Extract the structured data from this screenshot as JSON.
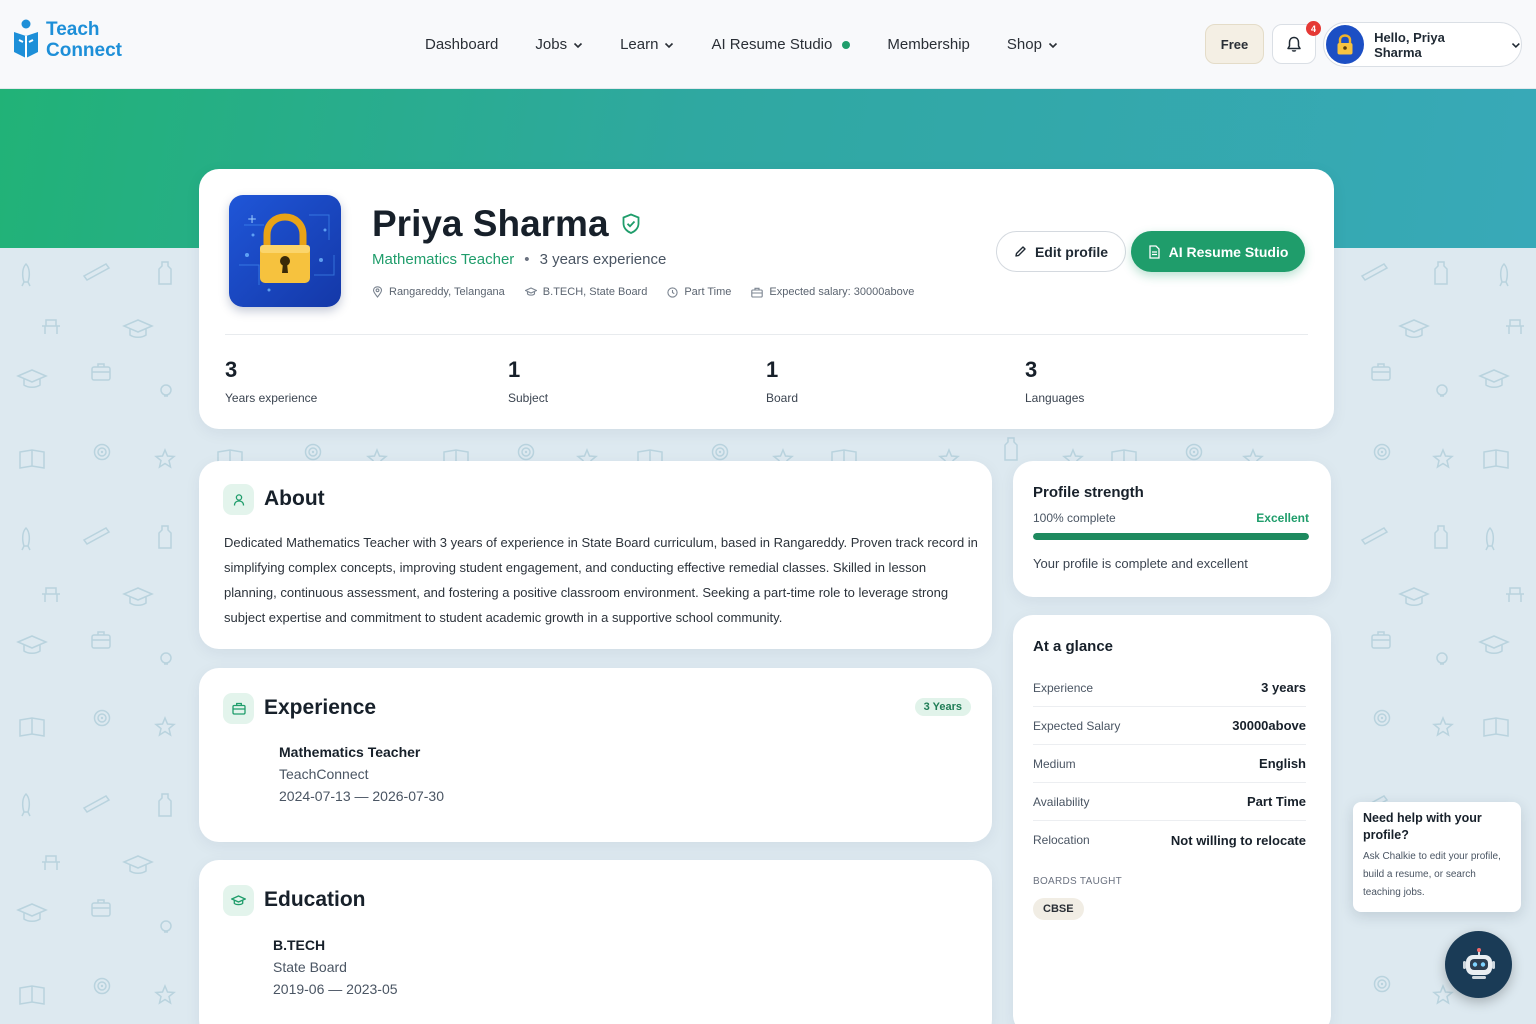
{
  "brand": {
    "line1": "Teach",
    "line2": "Connect",
    "color": "#1d8fd8"
  },
  "nav": {
    "items": [
      {
        "label": "Dashboard",
        "dropdown": false
      },
      {
        "label": "Jobs",
        "dropdown": true
      },
      {
        "label": "Learn",
        "dropdown": true
      },
      {
        "label": "AI Resume Studio",
        "dropdown": false,
        "live_dot": true
      },
      {
        "label": "Membership",
        "dropdown": false
      },
      {
        "label": "Shop",
        "dropdown": true
      }
    ]
  },
  "header": {
    "plan_label": "Free",
    "notification_count": "4",
    "greeting": "Hello, Priya Sharma"
  },
  "profile": {
    "name": "Priya Sharma",
    "role": "Mathematics Teacher",
    "separator": "•",
    "experience": "3 years experience",
    "meta": {
      "location": "Rangareddy, Telangana",
      "education": "B.TECH, State Board",
      "job_type": "Part Time",
      "salary": "Expected salary: 30000above"
    },
    "edit_label": "Edit profile",
    "ai_label": "AI Resume Studio",
    "stats": [
      {
        "value": "3",
        "label": "Years experience"
      },
      {
        "value": "1",
        "label": "Subject"
      },
      {
        "value": "1",
        "label": "Board"
      },
      {
        "value": "3",
        "label": "Languages"
      }
    ]
  },
  "about": {
    "title": "About",
    "text": "Dedicated Mathematics Teacher with 3 years of experience in State Board curriculum, based in Rangareddy. Proven track record in simplifying complex concepts, improving student engagement, and conducting effective remedial classes. Skilled in lesson planning, continuous assessment, and fostering a positive classroom environment. Seeking a part-time role to leverage strong subject expertise and commitment to student academic growth in a supportive school community."
  },
  "experience": {
    "title": "Experience",
    "badge": "3 Years",
    "items": [
      {
        "title": "Mathematics Teacher",
        "org": "TeachConnect",
        "dates": "2024-07-13 — 2026-07-30"
      }
    ]
  },
  "education": {
    "title": "Education",
    "items": [
      {
        "title": "B.TECH",
        "org": "State Board",
        "dates": "2019-06 — 2023-05"
      }
    ]
  },
  "strength": {
    "title": "Profile strength",
    "percent_label": "100% complete",
    "percent": 100,
    "level": "Excellent",
    "message": "Your profile is complete and excellent"
  },
  "glance": {
    "title": "At a glance",
    "rows": [
      {
        "key": "Experience",
        "value": "3 years"
      },
      {
        "key": "Expected Salary",
        "value": "30000above"
      },
      {
        "key": "Medium",
        "value": "English"
      },
      {
        "key": "Availability",
        "value": "Part Time"
      },
      {
        "key": "Relocation",
        "value": "Not willing to relocate"
      }
    ],
    "boards_label": "BOARDS TAUGHT",
    "boards": [
      "CBSE"
    ]
  },
  "help": {
    "title": "Need help with your profile?",
    "body": "Ask Chalkie to edit your profile, build a resume, or search teaching jobs."
  },
  "colors": {
    "accent": "#1f9d6b",
    "banner_start": "#21b277",
    "banner_end": "#38a9b8",
    "badge_red": "#e53935"
  }
}
